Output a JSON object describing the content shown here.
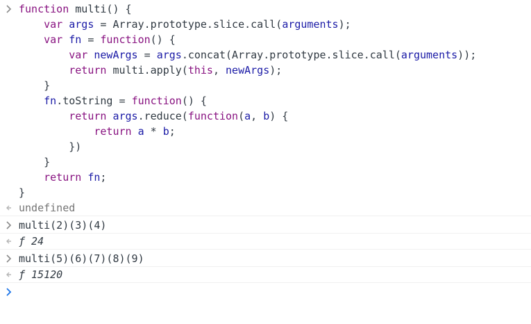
{
  "console": {
    "code_block": {
      "lines": [
        {
          "text": "function multi() {"
        },
        {
          "text": "    var args = Array.prototype.slice.call(arguments);"
        },
        {
          "text": "    var fn = function() {"
        },
        {
          "text": "        var newArgs = args.concat(Array.prototype.slice.call(arguments));"
        },
        {
          "text": "        return multi.apply(this, newArgs);"
        },
        {
          "text": "    }"
        },
        {
          "text": "    fn.toString = function() {"
        },
        {
          "text": "        return args.reduce(function(a, b) {"
        },
        {
          "text": "            return a * b;"
        },
        {
          "text": "        })"
        },
        {
          "text": "    }"
        },
        {
          "text": "    return fn;"
        },
        {
          "text": "}"
        }
      ]
    },
    "result_1": {
      "text": "undefined"
    },
    "input_2": {
      "text": "multi(2)(3)(4)"
    },
    "result_2": {
      "prefix": "ƒ",
      "value": "24"
    },
    "input_3": {
      "text": "multi(5)(6)(7)(8)(9)"
    },
    "result_3": {
      "prefix": "ƒ",
      "value": "15120"
    },
    "prompt": {
      "text": ""
    }
  },
  "colors": {
    "keyword": "#881280",
    "identifier": "#1a1aa6",
    "plain": "#303942",
    "muted": "#757575",
    "prompt_icon": "#8a8a8a",
    "divider": "#f0f0f0"
  },
  "icons": {
    "input": "chevron-right-icon",
    "output": "return-arrow-icon"
  }
}
